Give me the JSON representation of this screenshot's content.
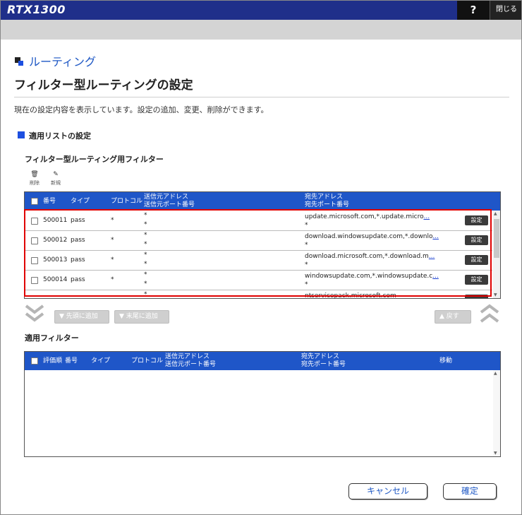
{
  "app": {
    "logo": "RTX1300",
    "help_label": "?",
    "close_label": "閉じる"
  },
  "section": {
    "title": "ルーティング"
  },
  "page": {
    "title": "フィルター型ルーティングの設定",
    "description": "現在の設定内容を表示しています。設定の追加、変更、削除ができます。",
    "subheading": "適用リストの設定",
    "filter_heading": "フィルター型ルーティング用フィルター"
  },
  "toolbar": {
    "delete_label": "削除",
    "new_label": "新規"
  },
  "filter_table": {
    "headers": {
      "number": "番号",
      "type": "タイプ",
      "protocol": "プロトコル",
      "src_addr": "送信元アドレス",
      "src_port": "送信元ポート番号",
      "dst_addr": "宛先アドレス",
      "dst_port": "宛先ポート番号"
    },
    "rows": [
      {
        "number": "500011",
        "type": "pass",
        "protocol": "*",
        "src_addr": "*",
        "src_port": "*",
        "dst_addr": "update.microsoft.com,*.update.micro",
        "dst_more": "...",
        "dst_port": "*",
        "action": "設定"
      },
      {
        "number": "500012",
        "type": "pass",
        "protocol": "*",
        "src_addr": "*",
        "src_port": "*",
        "dst_addr": "download.windowsupdate.com,*.downlo",
        "dst_more": "...",
        "dst_port": "*",
        "action": "設定"
      },
      {
        "number": "500013",
        "type": "pass",
        "protocol": "*",
        "src_addr": "*",
        "src_port": "*",
        "dst_addr": "download.microsoft.com,*.download.m",
        "dst_more": "...",
        "dst_port": "*",
        "action": "設定"
      },
      {
        "number": "500014",
        "type": "pass",
        "protocol": "*",
        "src_addr": "*",
        "src_port": "*",
        "dst_addr": "windowsupdate.com,*.windowsupdate.c",
        "dst_more": "...",
        "dst_port": "*",
        "action": "設定"
      },
      {
        "number": "",
        "type": "",
        "protocol": "",
        "src_addr": "*",
        "src_port": "",
        "dst_addr": "ntservicepack.microsoft.com",
        "dst_more": "",
        "dst_port": "",
        "action": ""
      }
    ]
  },
  "move_controls": {
    "add_top_label": "先頭に追加",
    "add_bottom_label": "末尾に追加",
    "back_label": "戻す"
  },
  "applied": {
    "heading": "適用フィルター",
    "headers": {
      "order": "評価順",
      "number": "番号",
      "type": "タイプ",
      "protocol": "プロトコル",
      "src_addr": "送信元アドレス",
      "src_port": "送信元ポート番号",
      "dst_addr": "宛先アドレス",
      "dst_port": "宛先ポート番号",
      "move": "移動"
    }
  },
  "footer": {
    "cancel_label": "キャンセル",
    "confirm_label": "確定"
  },
  "colors": {
    "brand_bar": "#1f2f8a",
    "header_blue": "#1f56c8",
    "highlight_red": "#e00000"
  }
}
